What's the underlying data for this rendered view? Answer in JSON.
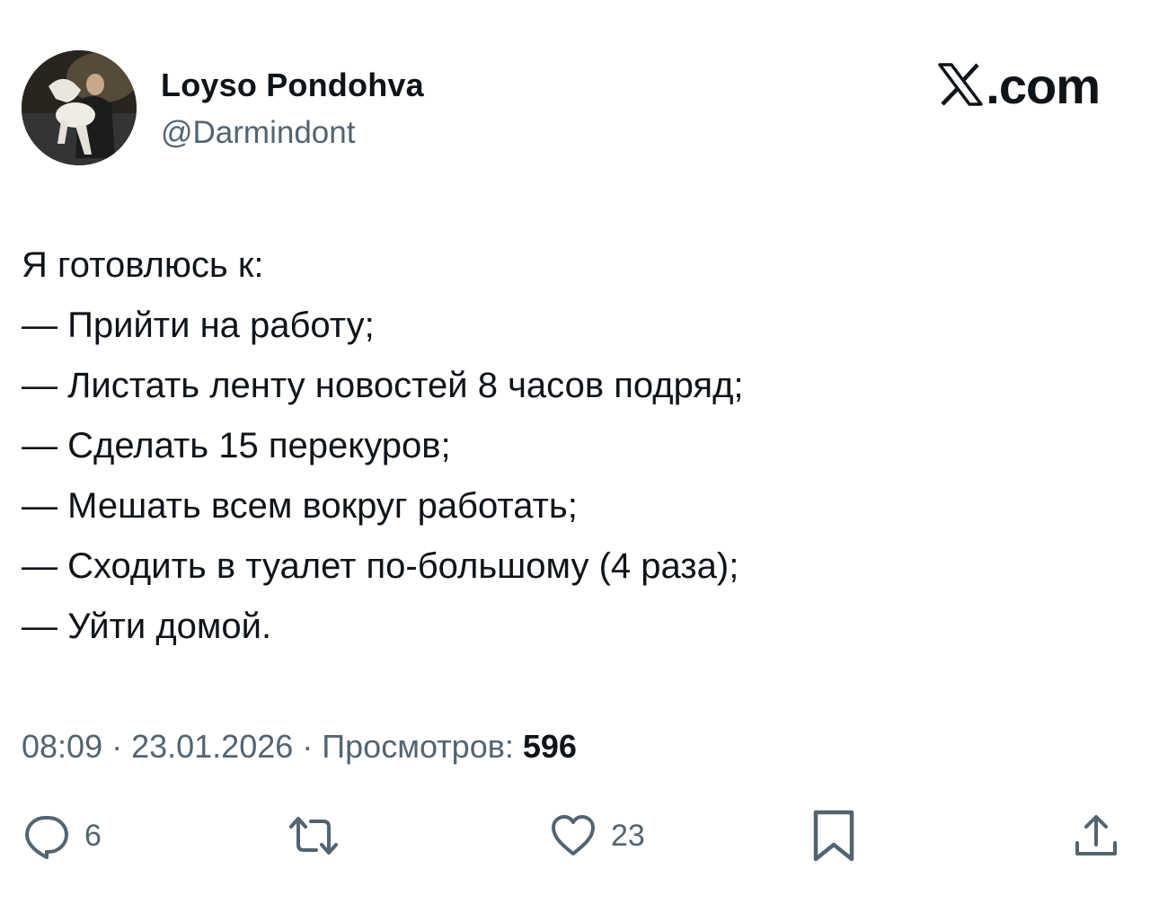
{
  "author": {
    "display_name": "Loyso Pondohva",
    "handle": "@Darmindont"
  },
  "brand": {
    "logo_icon": "x-logo-icon",
    "suffix": ".com"
  },
  "tweet": {
    "lines": [
      "Я готовлюсь к:",
      "— Прийти на работу;",
      "— Листать ленту новостей 8 часов подряд;",
      "— Сделать 15 перекуров;",
      "— Мешать всем вокруг работать;",
      "— Сходить в туалет по-большому (4 раза);",
      "— Уйти домой."
    ]
  },
  "meta": {
    "time": "08:09",
    "separator": " · ",
    "date": "23.01.2026",
    "views_label": "Просмотров: ",
    "views_count": "596"
  },
  "actions": {
    "reply": {
      "icon": "reply-icon",
      "count": "6"
    },
    "repost": {
      "icon": "repost-icon",
      "count": ""
    },
    "like": {
      "icon": "heart-icon",
      "count": "23"
    },
    "bookmark": {
      "icon": "bookmark-icon"
    },
    "share": {
      "icon": "share-icon"
    }
  },
  "colors": {
    "text": "#0f1419",
    "secondary": "#536471",
    "background": "#ffffff"
  }
}
